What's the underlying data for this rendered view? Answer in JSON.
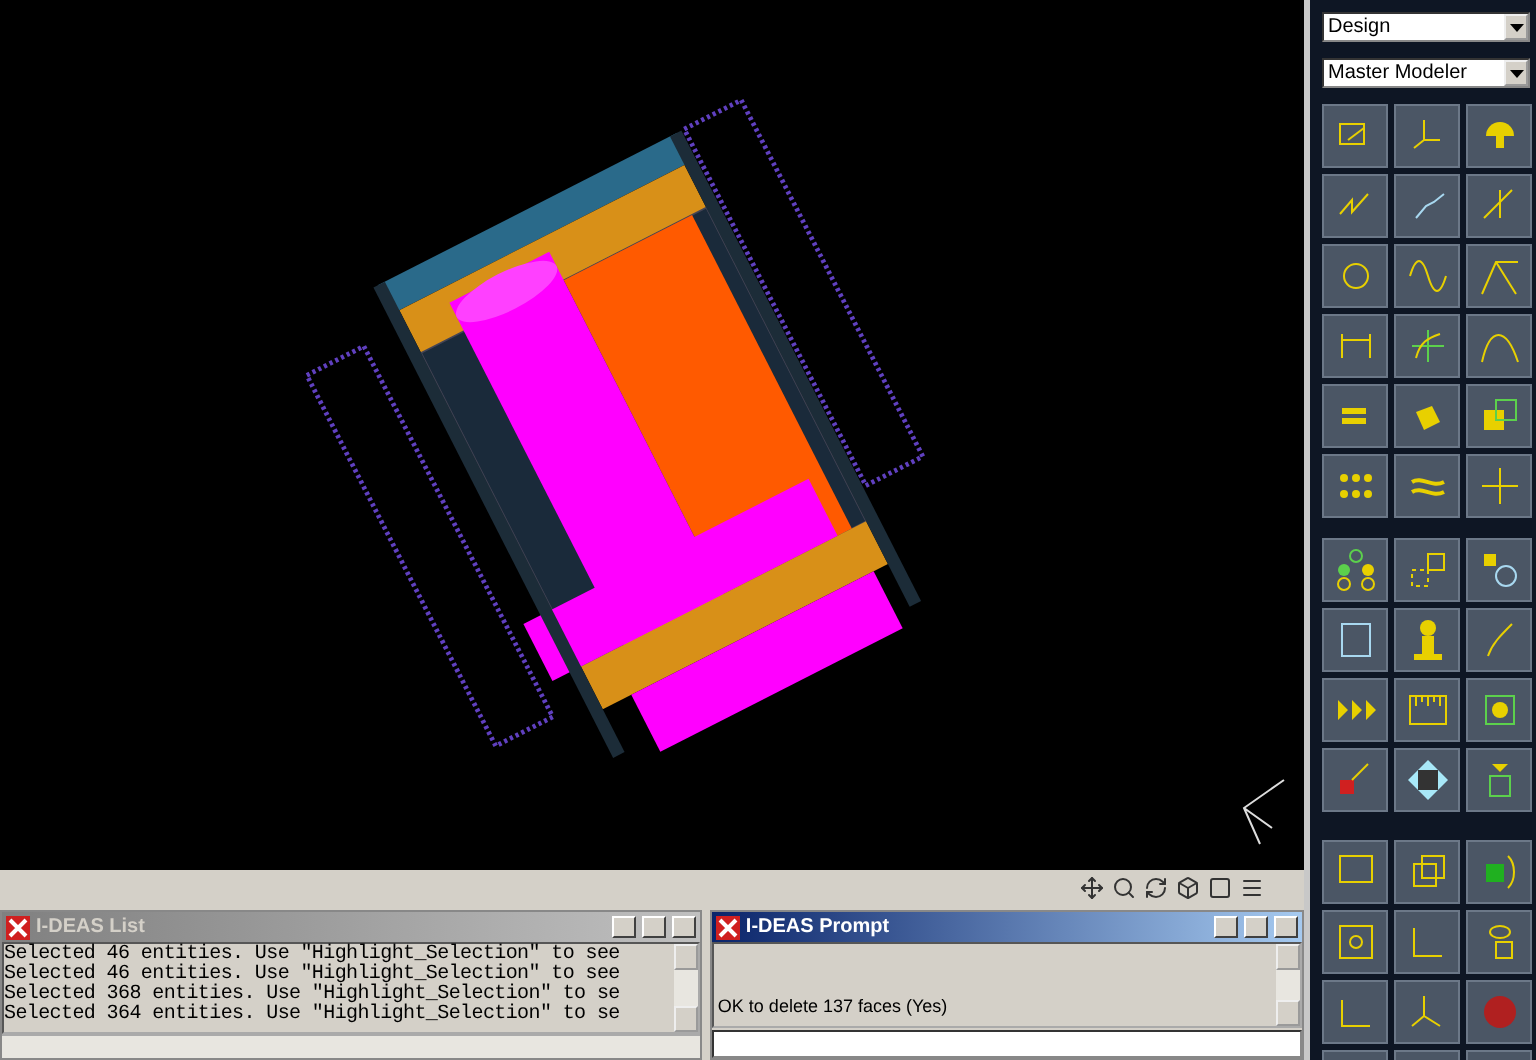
{
  "palette": {
    "application": "Design",
    "task": "Master Modeler"
  },
  "list_window": {
    "title": "I-DEAS List",
    "active": false,
    "lines": [
      "Selected 46 entities.  Use \"Highlight_Selection\" to see",
      "Selected 46 entities.  Use \"Highlight_Selection\" to see",
      "Selected 368 entities.  Use \"Highlight_Selection\" to se",
      "Selected 364 entities.  Use \"Highlight_Selection\" to se"
    ]
  },
  "prompt_window": {
    "title": "I-DEAS Prompt",
    "active": true,
    "message": "OK to delete 137 faces (Yes)"
  }
}
